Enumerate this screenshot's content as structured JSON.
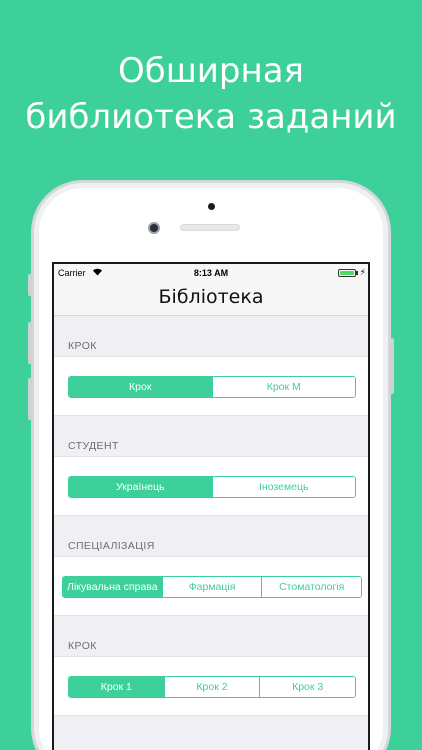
{
  "promo": {
    "line1": "Обширная",
    "line2": "библиотека заданий"
  },
  "status": {
    "carrier": "Carrier",
    "time": "8:13 AM",
    "wifi_icon": "wifi-icon",
    "battery_icon": "battery-icon",
    "battery_level": 1.0
  },
  "nav": {
    "title": "Бібліотека"
  },
  "sections": [
    {
      "header": "КРОК",
      "options": [
        "Крок",
        "Крок М"
      ],
      "selected": 0
    },
    {
      "header": "СТУДЕНТ",
      "options": [
        "Українець",
        "Іноземець"
      ],
      "selected": 0
    },
    {
      "header": "СПЕЦІАЛІЗАЦІЯ",
      "options": [
        "Лікувальна справа",
        "Фармація",
        "Стоматологія"
      ],
      "selected": 0
    },
    {
      "header": "КРОК",
      "options": [
        "Крок 1",
        "Крок 2",
        "Крок 3"
      ],
      "selected": 0
    }
  ],
  "colors": {
    "accent": "#3dd09a",
    "background": "#3dd09a",
    "screen_bg": "#efeff4"
  }
}
